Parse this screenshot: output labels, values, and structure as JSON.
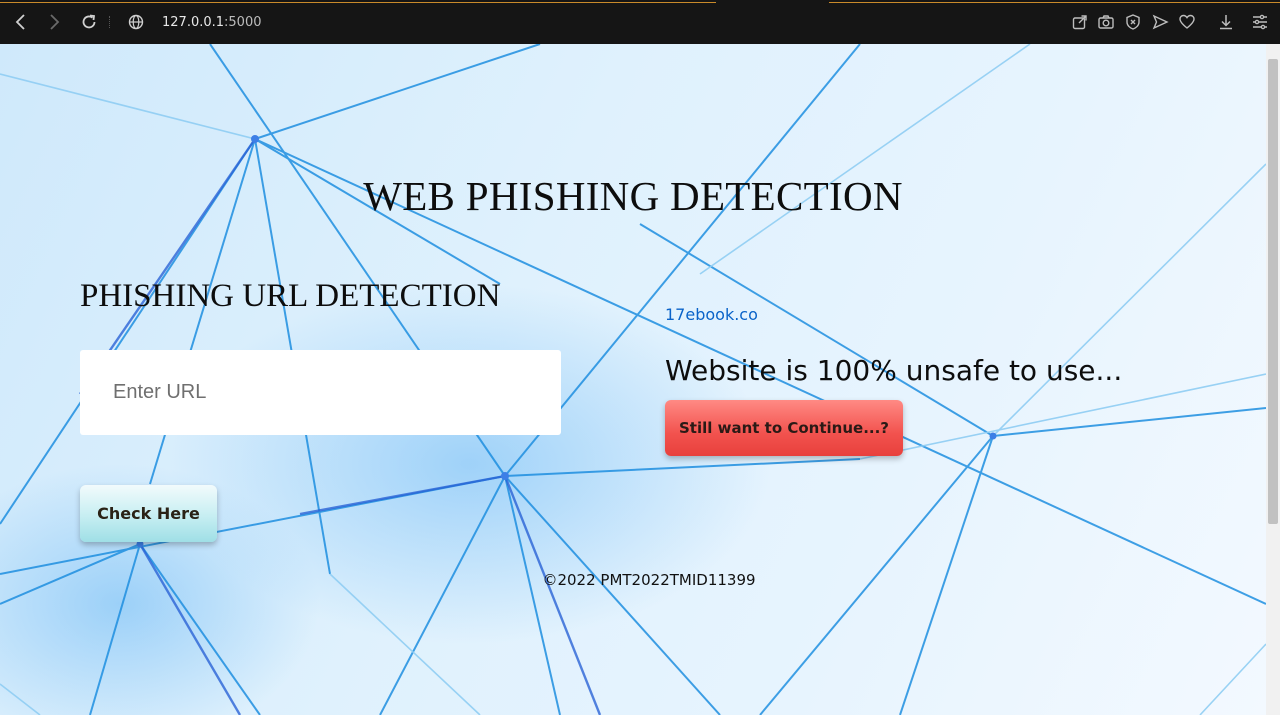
{
  "browser": {
    "address_host": "127.0.0.1",
    "address_port": ":5000",
    "icons": [
      "back-icon",
      "forward-icon",
      "reload-icon",
      "globe-icon",
      "share-icon",
      "camera-icon",
      "shield-icon",
      "send-icon",
      "heart-icon",
      "download-icon",
      "settings-sliders-icon"
    ]
  },
  "page": {
    "title": "WEB PHISHING DETECTION",
    "subtitle": "PHISHING URL DETECTION",
    "url_input_placeholder": "Enter URL",
    "url_input_value": "",
    "check_button_label": "Check Here",
    "checked_site": "17ebook.co",
    "result_text": "Website is 100% unsafe to use...",
    "continue_button_label": "Still want to Continue...?",
    "footer": "©2022 PMT2022TMID11399"
  },
  "colors": {
    "link": "#0a63c9",
    "danger_button": "#f2524e",
    "check_button": "#c6eef2",
    "background_tint": "#dff1fd"
  }
}
